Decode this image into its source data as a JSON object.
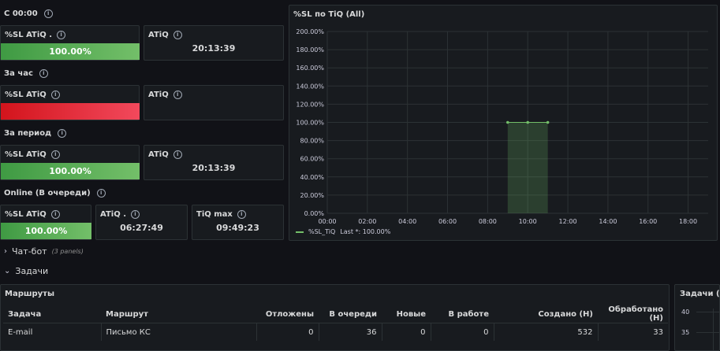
{
  "sections": {
    "since_midnight": "С 00:00",
    "hour": "За час",
    "period": "За период",
    "online": "Online (В очереди)"
  },
  "panels": {
    "r1_sl": {
      "title": "%SL ATiQ .",
      "value": "100.00%"
    },
    "r1_atiq": {
      "title": "ATiQ",
      "value": "20:13:39"
    },
    "r2_sl": {
      "title": "%SL ATiQ",
      "value": ""
    },
    "r2_atiq": {
      "title": "ATiQ",
      "value": ""
    },
    "r3_sl": {
      "title": "%SL ATiQ",
      "value": "100.00%"
    },
    "r3_atiq": {
      "title": "ATiQ",
      "value": "20:13:39"
    },
    "r4_sl": {
      "title": "%SL ATiQ",
      "value": "100.00%"
    },
    "r4_atiq": {
      "title": "ATiQ .",
      "value": "06:27:49"
    },
    "r4_tiqmax": {
      "title": "TiQ max",
      "value": "09:49:23"
    }
  },
  "colors": {
    "ok": "#73bf69",
    "bad": "#f2495c",
    "background": "#111217",
    "panel": "#181b1f"
  },
  "chart": {
    "title": "%SL по TiQ (All)",
    "legend_label": "%SL_TiQ",
    "legend_stat": "Last *: 100.00%"
  },
  "chart_data": {
    "type": "area",
    "title": "%SL по TiQ (All)",
    "series": [
      {
        "name": "%SL_TiQ",
        "x": [
          "09:00",
          "10:00",
          "11:00"
        ],
        "values": [
          100,
          100,
          100
        ]
      }
    ],
    "x_ticks": [
      "00:00",
      "02:00",
      "04:00",
      "06:00",
      "08:00",
      "10:00",
      "12:00",
      "14:00",
      "16:00",
      "18:00"
    ],
    "y_ticks": [
      "0.00%",
      "20.00%",
      "40.00%",
      "60.00%",
      "80.00%",
      "100.00%",
      "120.00%",
      "140.00%",
      "160.00%",
      "180.00%",
      "200.00%"
    ],
    "xlim": [
      "00:00",
      "19:00"
    ],
    "ylim": [
      0,
      200
    ],
    "grid": true,
    "legend": "bottom-left"
  },
  "rows": {
    "chatbot": {
      "label": "Чат-бот",
      "sub": "(3 panels)"
    },
    "tasks": {
      "label": "Задачи"
    }
  },
  "routes": {
    "title": "Маршруты",
    "columns": [
      "Задача",
      "Маршрут",
      "Отложены",
      "В очереди",
      "Новые",
      "В работе",
      "Создано (Н)",
      "Обработано (Н)"
    ],
    "rows": [
      [
        "E-mail",
        "Письмо КС",
        "0",
        "36",
        "0",
        "0",
        "532",
        "33"
      ]
    ]
  },
  "tasks_panel": {
    "title": "Задачи (All",
    "y_ticks": [
      "40",
      "35"
    ]
  }
}
